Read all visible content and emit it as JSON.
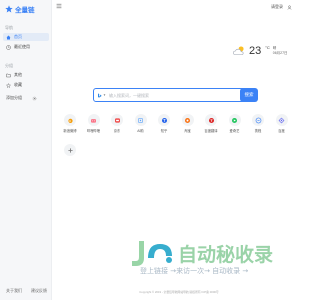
{
  "brand": {
    "name": "全量链"
  },
  "sidebar": {
    "sections": [
      {
        "title": "导航",
        "items": [
          {
            "label": "首页",
            "icon": "home-icon",
            "active": true
          },
          {
            "label": "最近使用",
            "icon": "clock-icon",
            "active": false
          }
        ]
      },
      {
        "title": "分组",
        "items": [
          {
            "label": "其他",
            "icon": "folder-icon",
            "active": false
          },
          {
            "label": "收藏",
            "icon": "star-icon",
            "active": false
          }
        ]
      }
    ],
    "settings_label": "添加分组",
    "footer": {
      "left": "关于我们",
      "right": "建议反馈"
    }
  },
  "header": {
    "login_label": "请登录"
  },
  "weather": {
    "temperature": "23",
    "unit": "°C",
    "condition": "晴",
    "date": "06月27日"
  },
  "search": {
    "engine_icon": "bing-icon",
    "placeholder": "输入搜索词，一键搜索",
    "button_label": "搜索"
  },
  "shortcuts": [
    {
      "label": "新浪微博",
      "color": "#f59e0b",
      "icon": "weibo-icon"
    },
    {
      "label": "哔哩哔哩",
      "color": "#fb7185",
      "icon": "bilibili-icon"
    },
    {
      "label": "京东",
      "color": "#ef4444",
      "icon": "jd-icon"
    },
    {
      "label": "AI助",
      "color": "#60a5fa",
      "icon": "ai-icon"
    },
    {
      "label": "知乎",
      "color": "#2563eb",
      "icon": "zhihu-icon"
    },
    {
      "label": "淘宝",
      "color": "#f97316",
      "icon": "taobao-icon"
    },
    {
      "label": "百度翻译",
      "color": "#dc2626",
      "icon": "fanyi-icon"
    },
    {
      "label": "爱奇艺",
      "color": "#22c55e",
      "icon": "iqiyi-icon"
    },
    {
      "label": "携程",
      "color": "#3b82f6",
      "icon": "ctrip-icon"
    },
    {
      "label": "百度",
      "color": "#6366f1",
      "icon": "baidu-icon"
    }
  ],
  "add_shortcut": {
    "icon": "plus-icon"
  },
  "footer_copy": "Copyright © 2019 - 全量链导航网站导航 版权所有 ICP备 0000号",
  "watermark": {
    "main": "自动秘收录",
    "sub": "登上链接 →来访一次→ 自动收录 →"
  },
  "colors": {
    "accent": "#3b82f6",
    "sidebar_bg": "#f6f7f9"
  }
}
